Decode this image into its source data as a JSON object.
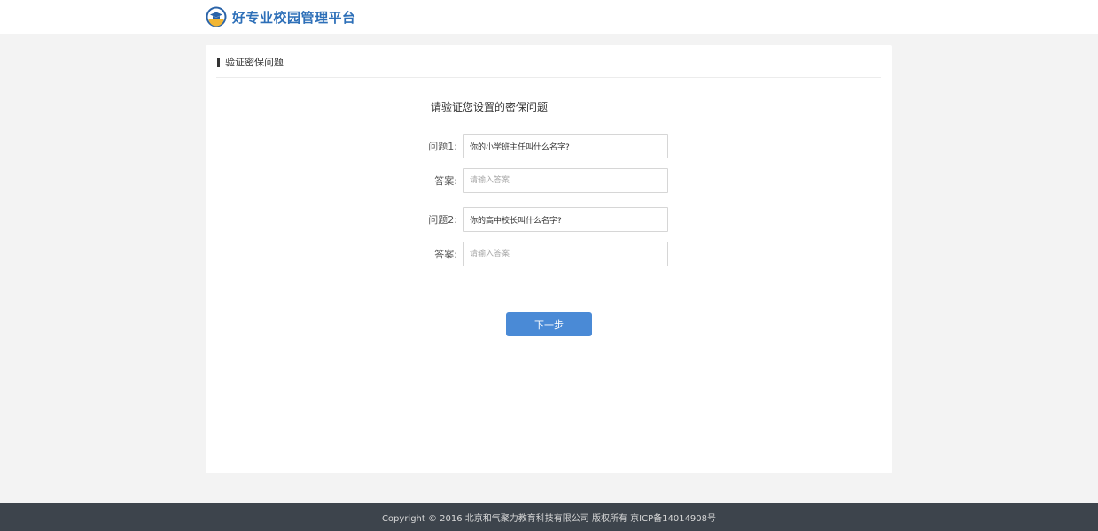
{
  "header": {
    "logo_icon": "school-emblem-icon",
    "title": "好专业校园管理平台",
    "brand_color": "#2d6fb8"
  },
  "card": {
    "title": "验证密保问题",
    "heading": "请验证您设置的密保问题"
  },
  "form": {
    "rows": [
      {
        "label": "问题1:",
        "value": "你的小学班主任叫什么名字?",
        "placeholder": ""
      },
      {
        "label": "答案:",
        "value": "",
        "placeholder": "请输入答案"
      },
      {
        "label": "问题2:",
        "value": "你的高中校长叫什么名字?",
        "placeholder": ""
      },
      {
        "label": "答案:",
        "value": "",
        "placeholder": "请输入答案"
      }
    ],
    "next_label": "下一步",
    "button_color": "#4a8ad6"
  },
  "footer": {
    "text": "Copyright © 2016 北京和气聚力教育科技有限公司 版权所有 京ICP备14014908号",
    "background": "#3d444c"
  }
}
